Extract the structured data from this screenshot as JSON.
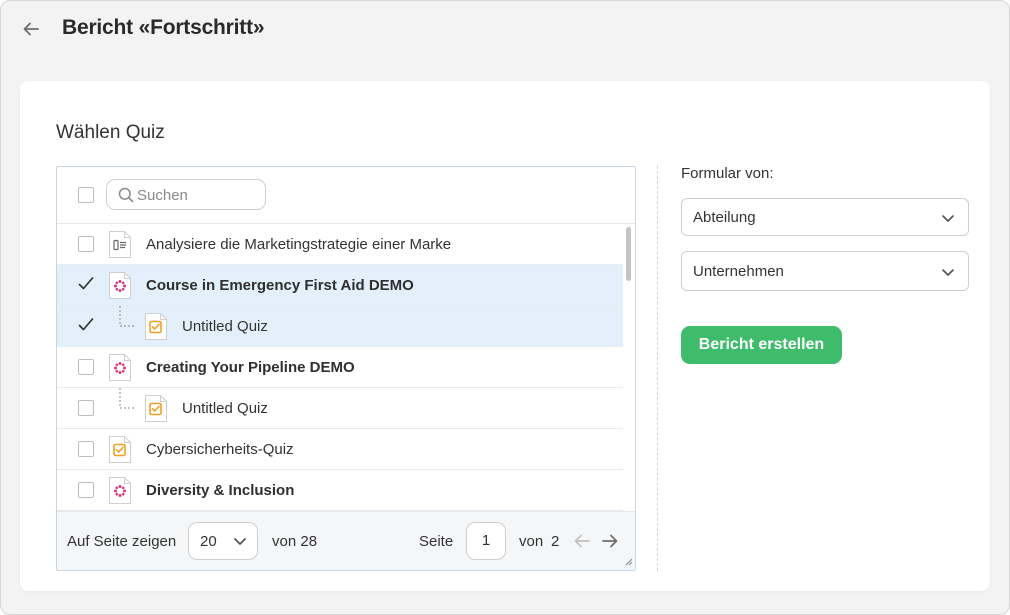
{
  "header": {
    "title": "Bericht «Fortschritt»"
  },
  "section_title": "Wählen Quiz",
  "search": {
    "placeholder": "Suchen",
    "value": ""
  },
  "list": {
    "items": [
      {
        "label": "Analysiere die Marketingstrategie einer Marke",
        "icon": "document-text-icon",
        "bold": false,
        "checked": false,
        "child": false,
        "selected": false
      },
      {
        "label": "Course in Emergency First Aid DEMO",
        "icon": "course-icon",
        "bold": true,
        "checked": true,
        "child": false,
        "selected": true
      },
      {
        "label": "Untitled Quiz",
        "icon": "quiz-icon",
        "bold": false,
        "checked": true,
        "child": true,
        "selected": true
      },
      {
        "label": "Creating Your Pipeline DEMO",
        "icon": "course-icon",
        "bold": true,
        "checked": false,
        "child": false,
        "selected": false
      },
      {
        "label": "Untitled Quiz",
        "icon": "quiz-icon",
        "bold": false,
        "checked": false,
        "child": true,
        "selected": false
      },
      {
        "label": "Cybersicherheits-Quiz",
        "icon": "quiz-icon",
        "bold": false,
        "checked": false,
        "child": false,
        "selected": false
      },
      {
        "label": "Diversity & Inclusion",
        "icon": "course-icon",
        "bold": true,
        "checked": false,
        "child": false,
        "selected": false
      }
    ]
  },
  "footer": {
    "per_page_label": "Auf Seite zeigen",
    "per_page_value": "20",
    "total_label": "von 28",
    "page_label": "Seite",
    "page_value": "1",
    "of_label": "von",
    "total_pages": "2"
  },
  "form": {
    "label": "Formular von:",
    "select1": "Abteilung",
    "select2": "Unternehmen",
    "submit_label": "Bericht erstellen"
  },
  "colors": {
    "accent_green": "#3fbc6b",
    "selected_row": "#e3f0fb",
    "quiz_orange": "#f0a028",
    "course_pink": "#d63a7e"
  }
}
